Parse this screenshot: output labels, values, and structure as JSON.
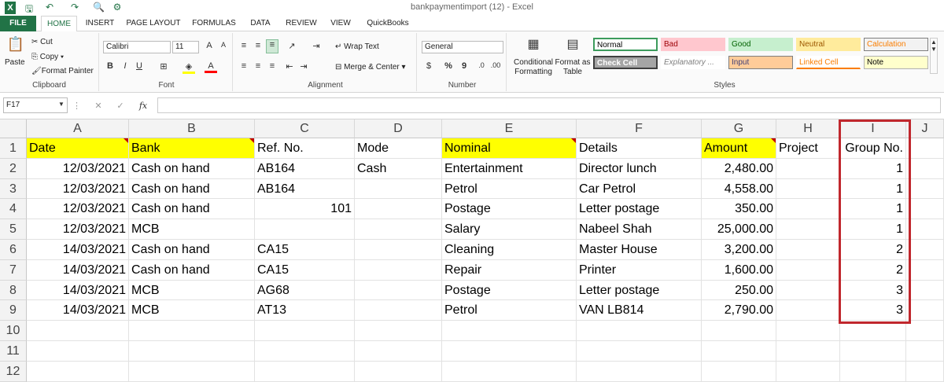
{
  "window": {
    "title": "bankpaymentimport (12) - Excel"
  },
  "tabs": [
    {
      "label": "FILE"
    },
    {
      "label": "HOME"
    },
    {
      "label": "INSERT"
    },
    {
      "label": "PAGE LAYOUT"
    },
    {
      "label": "FORMULAS"
    },
    {
      "label": "DATA"
    },
    {
      "label": "REVIEW"
    },
    {
      "label": "VIEW"
    },
    {
      "label": "QuickBooks"
    }
  ],
  "ribbon": {
    "clipboard": {
      "paste": "Paste",
      "cut": "Cut",
      "copy": "Copy",
      "format_painter": "Format Painter",
      "label": "Clipboard"
    },
    "font": {
      "name": "Calibri",
      "size": "11",
      "bold": "B",
      "italic": "I",
      "underline": "U",
      "label": "Font"
    },
    "alignment": {
      "wrap_text": "Wrap Text",
      "merge_center": "Merge & Center",
      "label": "Alignment"
    },
    "number": {
      "format": "General",
      "currency": "$",
      "percent": "%",
      "comma": "9",
      "label": "Number"
    },
    "styles": {
      "conditional_formatting": "Conditional Formatting",
      "format_as_table": "Format as Table",
      "label": "Styles",
      "items": [
        {
          "label": "Normal",
          "bg": "#ffffff",
          "fg": "#000000",
          "border": "#3c9b5c"
        },
        {
          "label": "Bad",
          "bg": "#ffc7ce",
          "fg": "#9c0006",
          "border": "#ffc7ce"
        },
        {
          "label": "Good",
          "bg": "#c6efce",
          "fg": "#006100",
          "border": "#c6efce"
        },
        {
          "label": "Neutral",
          "bg": "#ffeb9c",
          "fg": "#9c5700",
          "border": "#ffeb9c"
        },
        {
          "label": "Calculation",
          "bg": "#f2f2f2",
          "fg": "#fa7d00",
          "border": "#7f7f7f"
        },
        {
          "label": "Check Cell",
          "bg": "#a5a5a5",
          "fg": "#ffffff",
          "border": "#3f3f3f"
        },
        {
          "label": "Explanatory ...",
          "bg": "#ffffff",
          "fg": "#7f7f7f",
          "border": "#ffffff"
        },
        {
          "label": "Input",
          "bg": "#ffcc99",
          "fg": "#3f3f76",
          "border": "#7f7f7f"
        },
        {
          "label": "Linked Cell",
          "bg": "#ffffff",
          "fg": "#fa7d00",
          "border": "#ffffff"
        },
        {
          "label": "Note",
          "bg": "#ffffcc",
          "fg": "#000000",
          "border": "#b2b2b2"
        }
      ]
    }
  },
  "formula_bar": {
    "name_box": "F17",
    "fx": "fx",
    "value": ""
  },
  "sheet": {
    "columns": [
      "A",
      "B",
      "C",
      "D",
      "E",
      "F",
      "G",
      "H",
      "I",
      "J"
    ],
    "rows": [
      [
        "Date",
        "Bank",
        "Ref. No.",
        "Mode",
        "Nominal",
        "Details",
        "Amount",
        "Project",
        "Group No."
      ],
      [
        "12/03/2021",
        "Cash on hand",
        "AB164",
        "Cash",
        "Entertainment",
        "Director lunch",
        "2,480.00",
        "",
        "1"
      ],
      [
        "12/03/2021",
        "Cash on hand",
        "AB164",
        "",
        "Petrol",
        "Car Petrol",
        "4,558.00",
        "",
        "1"
      ],
      [
        "12/03/2021",
        "Cash on hand",
        "101",
        "",
        "Postage",
        "Letter postage",
        "350.00",
        "",
        "1"
      ],
      [
        "12/03/2021",
        "MCB",
        "",
        "",
        "Salary",
        "Nabeel Shah",
        "25,000.00",
        "",
        "1"
      ],
      [
        "14/03/2021",
        "Cash on hand",
        "CA15",
        "",
        "Cleaning",
        "Master House",
        "3,200.00",
        "",
        "2"
      ],
      [
        "14/03/2021",
        "Cash on hand",
        "CA15",
        "",
        "Repair",
        "Printer",
        "1,600.00",
        "",
        "2"
      ],
      [
        "14/03/2021",
        "MCB",
        "AG68",
        "",
        "Postage",
        "Letter postage",
        "250.00",
        "",
        "3"
      ],
      [
        "14/03/2021",
        "MCB",
        "AT13",
        "",
        "Petrol",
        "VAN LB814",
        "2,790.00",
        "",
        "3"
      ],
      [
        "",
        "",
        "",
        "",
        "",
        "",
        "",
        "",
        ""
      ],
      [
        "",
        "",
        "",
        "",
        "",
        "",
        "",
        "",
        ""
      ],
      [
        "",
        "",
        "",
        "",
        "",
        "",
        "",
        "",
        ""
      ]
    ],
    "row_numbers": [
      "1",
      "2",
      "3",
      "4",
      "5",
      "6",
      "7",
      "8",
      "9",
      "10",
      "11",
      "12"
    ],
    "highlight_color": "#ffff00",
    "highlighted_headers": [
      "A",
      "B",
      "E",
      "G"
    ]
  }
}
